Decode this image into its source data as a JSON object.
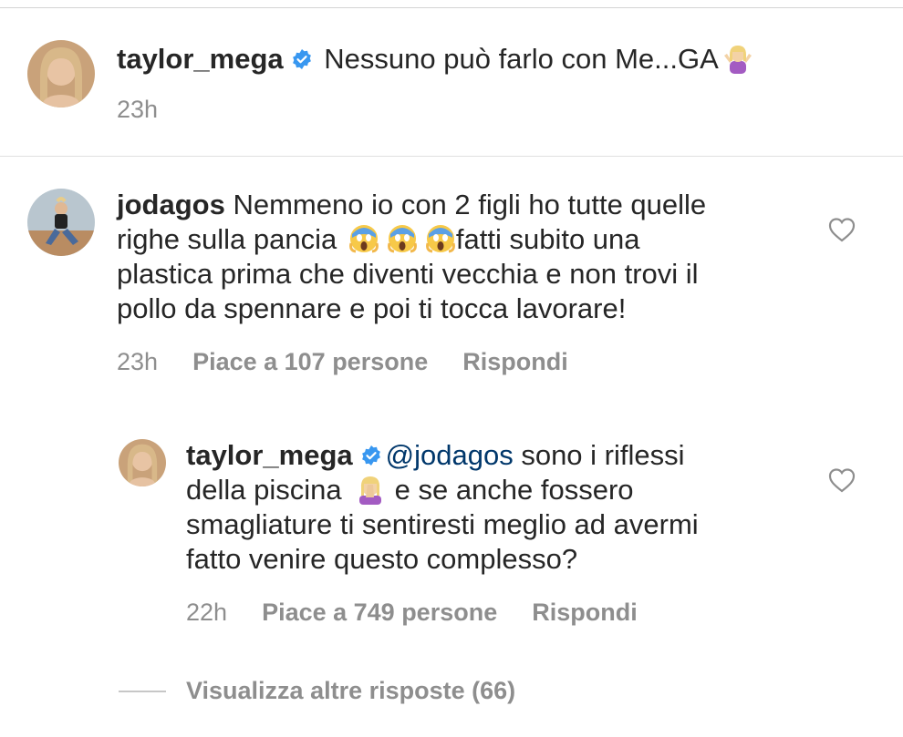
{
  "caption": {
    "username": "taylor_mega",
    "text": "Nessuno può farlo con Me...GA",
    "time": "23h"
  },
  "comments": [
    {
      "username": "jodagos",
      "line1": "Nemmeno io con 2 figli ho tutte quelle",
      "line2_start": "righe sulla pancia",
      "line2_end": "fatti subito una",
      "line3": "plastica prima che diventi vecchia e non trovi il",
      "line4": "pollo da spennare e poi ti tocca lavorare!",
      "time": "23h",
      "likes": "Piace a 107 persone",
      "reply": "Rispondi"
    }
  ],
  "reply": {
    "username": "taylor_mega",
    "mention": "@jodagos",
    "line1_rest": "sono i riflessi",
    "line2_start": "della piscina",
    "line2_end": "e se anche fossero",
    "line3": "smagliature ti sentiresti meglio ad avermi",
    "line4": "fatto venire questo complesso?",
    "time": "22h",
    "likes": "Piace a 749 persone",
    "reply": "Rispondi"
  },
  "view_more": "Visualizza altre risposte (66)",
  "icons": {
    "verified": "verified-badge-icon",
    "heart": "heart-outline-icon",
    "shrug": "person-shrugging-emoji",
    "scream": "face-screaming-emoji",
    "facepalm": "person-facepalming-emoji"
  },
  "colors": {
    "text": "#262626",
    "secondary": "#8e8e8e",
    "verified_blue": "#3897f0",
    "mention": "#00376b"
  }
}
